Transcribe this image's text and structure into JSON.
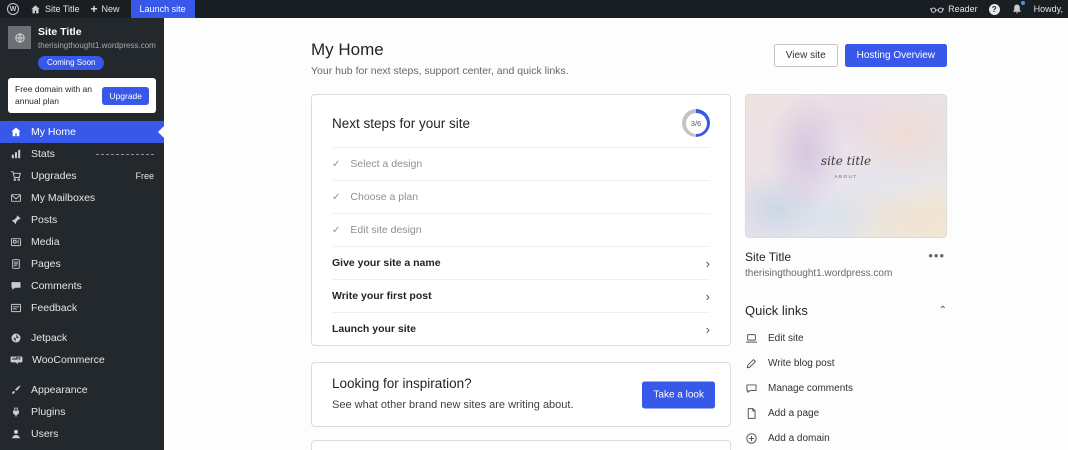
{
  "glyphs": {
    "w_logo": "W",
    "plus": "+",
    "question": "?",
    "check": "✓",
    "chevron_right": "›",
    "chevron_up": "⌃",
    "ellipsis": "•••"
  },
  "admin_bar": {
    "site_title": "Site Title",
    "new_label": "New",
    "launch_site_label": "Launch site",
    "reader_label": "Reader",
    "howdy_label": "Howdy,"
  },
  "sidebar": {
    "site_card": {
      "title": "Site Title",
      "domain": "therisingthought1.wordpress.com",
      "badge": "Coming Soon"
    },
    "upsell": {
      "text": "Free domain with an annual plan",
      "button": "Upgrade"
    },
    "items": [
      {
        "label": "My Home"
      },
      {
        "label": "Stats"
      },
      {
        "label": "Upgrades",
        "meta": "Free"
      },
      {
        "label": "My Mailboxes"
      },
      {
        "label": "Posts"
      },
      {
        "label": "Media"
      },
      {
        "label": "Pages"
      },
      {
        "label": "Comments"
      },
      {
        "label": "Feedback"
      },
      {
        "label": "Jetpack"
      },
      {
        "label": "WooCommerce"
      },
      {
        "label": "Appearance"
      },
      {
        "label": "Plugins"
      },
      {
        "label": "Users"
      }
    ]
  },
  "main": {
    "title": "My Home",
    "subtitle": "Your hub for next steps, support center, and quick links.",
    "view_site_button": "View site",
    "hosting_overview_button": "Hosting Overview",
    "next_steps": {
      "title": "Next steps for your site",
      "progress": "3/6",
      "completed": [
        "Select a design",
        "Choose a plan",
        "Edit site design"
      ],
      "pending": [
        "Give your site a name",
        "Write your first post",
        "Launch your site"
      ]
    },
    "inspiration": {
      "title": "Looking for inspiration?",
      "subtitle": "See what other brand new sites are writing about.",
      "button": "Take a look"
    }
  },
  "aside": {
    "preview": {
      "script_title": "site title",
      "nav_label": "ABOUT"
    },
    "site_title": "Site Title",
    "domain": "therisingthought1.wordpress.com",
    "quick_links": {
      "title": "Quick links",
      "items": [
        "Edit site",
        "Write blog post",
        "Manage comments",
        "Add a page",
        "Add a domain"
      ]
    }
  },
  "colors": {
    "accent": "#3858e9",
    "adminbar_bg": "#191e23",
    "sidebar_bg": "#23282d",
    "content_bg": "#fdfdfd"
  }
}
